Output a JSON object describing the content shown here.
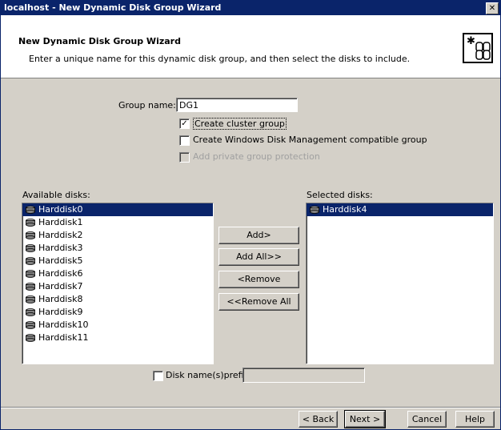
{
  "window": {
    "title": "localhost - New Dynamic Disk Group Wizard",
    "close_glyph": "✕"
  },
  "header": {
    "title": "New Dynamic Disk Group Wizard",
    "subtitle": "Enter a unique name for this dynamic disk group, and then select the disks to include.",
    "icon": "disk-group-wizard-icon"
  },
  "form": {
    "group_name_label": "Group name:",
    "group_name_value": "DG1",
    "create_cluster_group": {
      "label": "Create cluster group",
      "checked": true
    },
    "create_windows_compatible": {
      "label": "Create Windows Disk Management compatible group",
      "checked": false
    },
    "add_private_protection": {
      "label": "Add private group protection",
      "checked": false,
      "disabled": true
    }
  },
  "available": {
    "label": "Available disks:",
    "items": [
      "Harddisk0",
      "Harddisk1",
      "Harddisk2",
      "Harddisk3",
      "Harddisk5",
      "Harddisk6",
      "Harddisk7",
      "Harddisk8",
      "Harddisk9",
      "Harddisk10",
      "Harddisk11"
    ],
    "selected_index": 0
  },
  "selected": {
    "label": "Selected disks:",
    "items": [
      "Harddisk4"
    ],
    "selected_index": 0
  },
  "move_buttons": {
    "add": "Add>",
    "add_all": "Add All>>",
    "remove": "<Remove",
    "remove_all": "<<Remove All"
  },
  "prefix": {
    "label": "Disk name(s)prefix:",
    "checked": false,
    "value": ""
  },
  "footer": {
    "back": "< Back",
    "next": "Next >",
    "cancel": "Cancel",
    "help": "Help"
  },
  "colors": {
    "title_bar": "#0a246a",
    "selection": "#0a246a",
    "dialog_face": "#d4d0c8"
  }
}
